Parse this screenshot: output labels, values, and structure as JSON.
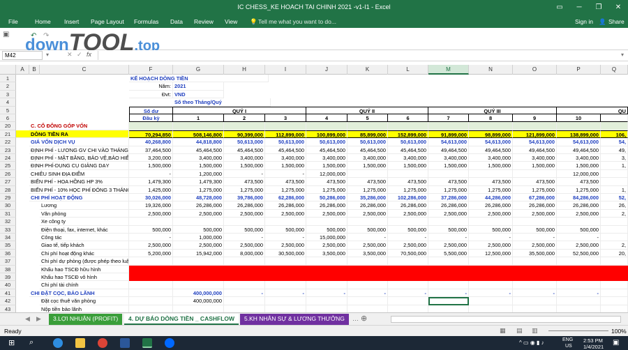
{
  "window": {
    "title": "IC CHESS_KE HOACH TAI CHINH 2021 -v1-I1 - Excel",
    "minimize": "─",
    "restore": "❐",
    "close": "✕"
  },
  "ribbon": {
    "tabs": [
      "File",
      "Home",
      "Insert",
      "Page Layout",
      "Formulas",
      "Data",
      "Review",
      "View"
    ],
    "tell_me": "Tell me what you want to do...",
    "sign_in": "Sign in",
    "share": "Share"
  },
  "formula_bar": {
    "name_box": "M42",
    "fx": "fx"
  },
  "watermark": {
    "part1": "down",
    "part2": "TOOL",
    "part3": ".top"
  },
  "columns": [
    "A",
    "B",
    "C",
    "F",
    "G",
    "H",
    "I",
    "J",
    "K",
    "L",
    "M",
    "N",
    "O",
    "P",
    "Q"
  ],
  "header_block": {
    "title": "KẾ HOẠCH DÒNG TIỀN",
    "nam_label": "Năm:",
    "nam_value": "2021",
    "dvt_label": "Đvt:",
    "dvt_value": "VND",
    "so_theo": "Số theo Tháng/Quý",
    "so_du": "Số dư",
    "dau_ky": "Đầu kỳ",
    "quy1": "QUÝ I",
    "quy2": "QUÝ II",
    "quy3": "QUÝ III",
    "quy4": "QU",
    "months": [
      "1",
      "2",
      "3",
      "4",
      "5",
      "6",
      "7",
      "8",
      "9",
      "10"
    ]
  },
  "rows": [
    {
      "n": "20",
      "label": "C.   CỔ ĐÔNG GÓP VỐN",
      "style": "section",
      "vals": [
        "",
        "",
        "",
        "",
        "",
        "",
        "",
        "",
        "",
        "",
        ""
      ]
    },
    {
      "n": "21",
      "label": "DÒNG TIỀN RA",
      "style": "yellow",
      "vals": [
        "70,294,850",
        "508,146,800",
        "90,399,000",
        "112,899,000",
        "100,899,000",
        "85,899,000",
        "152,899,000",
        "91,899,000",
        "98,899,000",
        "121,899,000",
        "138,899,000",
        "106,"
      ]
    },
    {
      "n": "22",
      "label": "GIÁ VỐN DỊCH VỤ",
      "style": "blue",
      "vals": [
        "40,268,800",
        "44,818,800",
        "50,613,000",
        "50,613,000",
        "50,613,000",
        "50,613,000",
        "50,613,000",
        "54,613,000",
        "54,613,000",
        "54,613,000",
        "54,613,000",
        "54,"
      ]
    },
    {
      "n": "23",
      "label": "ĐỊNH PHÍ - LƯƠNG GV CHI VÀO THÁNG",
      "style": "plain",
      "vals": [
        "37,464,500",
        "45,464,500",
        "45,464,500",
        "45,464,500",
        "45,464,500",
        "45,464,500",
        "45,464,500",
        "49,464,500",
        "49,464,500",
        "49,464,500",
        "49,464,500",
        "49,"
      ]
    },
    {
      "n": "24",
      "label": "ĐỊNH PHÍ - MẶT BẰNG, BẢO VỆ,BẢO HIỂM",
      "style": "plain",
      "vals": [
        "3,200,000",
        "3,400,000",
        "3,400,000",
        "3,400,000",
        "3,400,000",
        "3,400,000",
        "3,400,000",
        "3,400,000",
        "3,400,000",
        "3,400,000",
        "3,400,000",
        "3,"
      ]
    },
    {
      "n": "25",
      "label": "ĐỊNH PHÍ-DỤNG CỤ GIẢNG DẠY",
      "style": "plain",
      "vals": [
        "1,500,000",
        "1,500,000",
        "1,500,000",
        "1,500,000",
        "1,500,000",
        "1,500,000",
        "1,500,000",
        "1,500,000",
        "1,500,000",
        "1,500,000",
        "1,500,000",
        "1,"
      ]
    },
    {
      "n": "26",
      "label": "CHIÊU SINH ĐỊA ĐIỂM",
      "style": "plain",
      "vals": [
        "-",
        "1,200,000",
        "-",
        "-",
        "12,000,000",
        "",
        "",
        "",
        "",
        "",
        "12,000,000",
        ""
      ]
    },
    {
      "n": "27",
      "label": "BIẾN PHÍ - HOA HỒNG HP 3%",
      "style": "plain",
      "vals": [
        "1,479,300",
        "1,479,300",
        "473,500",
        "473,500",
        "473,500",
        "473,500",
        "473,500",
        "473,500",
        "473,500",
        "473,500",
        "473,500",
        ""
      ]
    },
    {
      "n": "28",
      "label": "BIẾN PHÍ - 10% HỌC PHÍ ĐÓNG 3 THÁNG",
      "style": "plain",
      "vals": [
        "1,425,000",
        "1,275,000",
        "1,275,000",
        "1,275,000",
        "1,275,000",
        "1,275,000",
        "1,275,000",
        "1,275,000",
        "1,275,000",
        "1,275,000",
        "1,275,000",
        "1,"
      ]
    },
    {
      "n": "29",
      "label": "CHI PHÍ HOẠT ĐỘNG",
      "style": "blue",
      "vals": [
        "30,026,000",
        "48,728,000",
        "39,786,000",
        "62,286,000",
        "50,286,000",
        "35,286,000",
        "102,286,000",
        "37,286,000",
        "44,286,000",
        "67,286,000",
        "84,286,000",
        "52,"
      ]
    },
    {
      "n": "30",
      "label": "Lương",
      "style": "sub",
      "vals": [
        "19,326,000",
        "26,286,000",
        "26,286,000",
        "26,286,000",
        "26,286,000",
        "26,286,000",
        "26,286,000",
        "26,286,000",
        "26,286,000",
        "26,286,000",
        "26,286,000",
        "26,"
      ]
    },
    {
      "n": "31",
      "label": "Văn phòng",
      "style": "sub",
      "vals": [
        "2,500,000",
        "2,500,000",
        "2,500,000",
        "2,500,000",
        "2,500,000",
        "2,500,000",
        "2,500,000",
        "2,500,000",
        "2,500,000",
        "2,500,000",
        "2,500,000",
        "2,"
      ]
    },
    {
      "n": "32",
      "label": "Xe công ty",
      "style": "sub",
      "vals": [
        "",
        "",
        "",
        "",
        "",
        "",
        "",
        "",
        "",
        "",
        "",
        ""
      ]
    },
    {
      "n": "33",
      "label": "Điện thoại, fax, internet, khác",
      "style": "sub",
      "vals": [
        "500,000",
        "500,000",
        "500,000",
        "500,000",
        "500,000",
        "500,000",
        "500,000",
        "500,000",
        "500,000",
        "500,000",
        "500,000",
        ""
      ]
    },
    {
      "n": "34",
      "label": "Công tác",
      "style": "sub",
      "vals": [
        "-",
        "1,000,000",
        "-",
        "-",
        "15,000,000",
        "-",
        "-",
        "-",
        "-",
        "-",
        "-",
        ""
      ]
    },
    {
      "n": "35",
      "label": "Giao tế, tiếp khách",
      "style": "sub",
      "vals": [
        "2,500,000",
        "2,500,000",
        "2,500,000",
        "2,500,000",
        "2,500,000",
        "2,500,000",
        "2,500,000",
        "2,500,000",
        "2,500,000",
        "2,500,000",
        "2,500,000",
        "2,"
      ]
    },
    {
      "n": "36",
      "label": "Chi phí hoạt động khác",
      "style": "sub",
      "vals": [
        "5,200,000",
        "15,942,000",
        "8,000,000",
        "30,500,000",
        "3,500,000",
        "3,500,000",
        "70,500,000",
        "5,500,000",
        "12,500,000",
        "35,500,000",
        "52,500,000",
        "20,"
      ]
    },
    {
      "n": "37",
      "label": "Chi phí dự phòng (được phép theo luật)",
      "style": "sub",
      "vals": [
        "",
        "",
        "",
        "",
        "",
        "",
        "",
        "",
        "",
        "",
        "",
        ""
      ]
    },
    {
      "n": "38",
      "label": "Khấu hao TSCĐ hữu hình",
      "style": "red",
      "vals": [
        "",
        "",
        "",
        "",
        "",
        "",
        "",
        "",
        "",
        "",
        "",
        ""
      ]
    },
    {
      "n": "39",
      "label": "Khấu hao TSCĐ vô hình",
      "style": "red",
      "vals": [
        "",
        "",
        "",
        "",
        "",
        "",
        "",
        "",
        "",
        "",
        "",
        ""
      ]
    },
    {
      "n": "40",
      "label": "Chi phí tài chính",
      "style": "sub",
      "vals": [
        "",
        "",
        "",
        "",
        "",
        "",
        "",
        "",
        "",
        "",
        "",
        ""
      ]
    },
    {
      "n": "41",
      "label": "CHI ĐẶT CỌC, BẢO LÃNH",
      "style": "blue",
      "vals": [
        "",
        "400,000,000",
        "-",
        "-",
        "-",
        "-",
        "-",
        "-",
        "-",
        "-",
        "-",
        ""
      ]
    },
    {
      "n": "42",
      "label": "Đặt cọc thuê văn phòng",
      "style": "sub",
      "vals": [
        "",
        "400,000,000",
        "",
        "",
        "",
        "",
        "",
        "",
        "",
        "",
        "",
        ""
      ]
    },
    {
      "n": "43",
      "label": "Nộp tiền bảo lãnh",
      "style": "sub",
      "vals": [
        "",
        "",
        "",
        "",
        "",
        "",
        "",
        "",
        "",
        "",
        "",
        ""
      ]
    }
  ],
  "sheet_tabs": [
    {
      "label": "3.LỢI NHUẬN (PROFIT)",
      "color": "#3a9e3a"
    },
    {
      "label": "4. DỰ BÁO DÒNG TIỀN _ CASHFLOW",
      "color": "#ffffff"
    },
    {
      "label": "5.KH NHÂN SỰ & LƯƠNG THƯỞNG",
      "color": "#7030a0"
    }
  ],
  "status": {
    "ready": "Ready",
    "zoom": "100%"
  },
  "taskbar": {
    "time": "2:53 PM",
    "date": "1/4/2021",
    "lang1": "ENG",
    "lang2": "US"
  },
  "colors": {
    "excel_green": "#217346",
    "yellow": "#ffff00",
    "red": "#ff0000"
  }
}
